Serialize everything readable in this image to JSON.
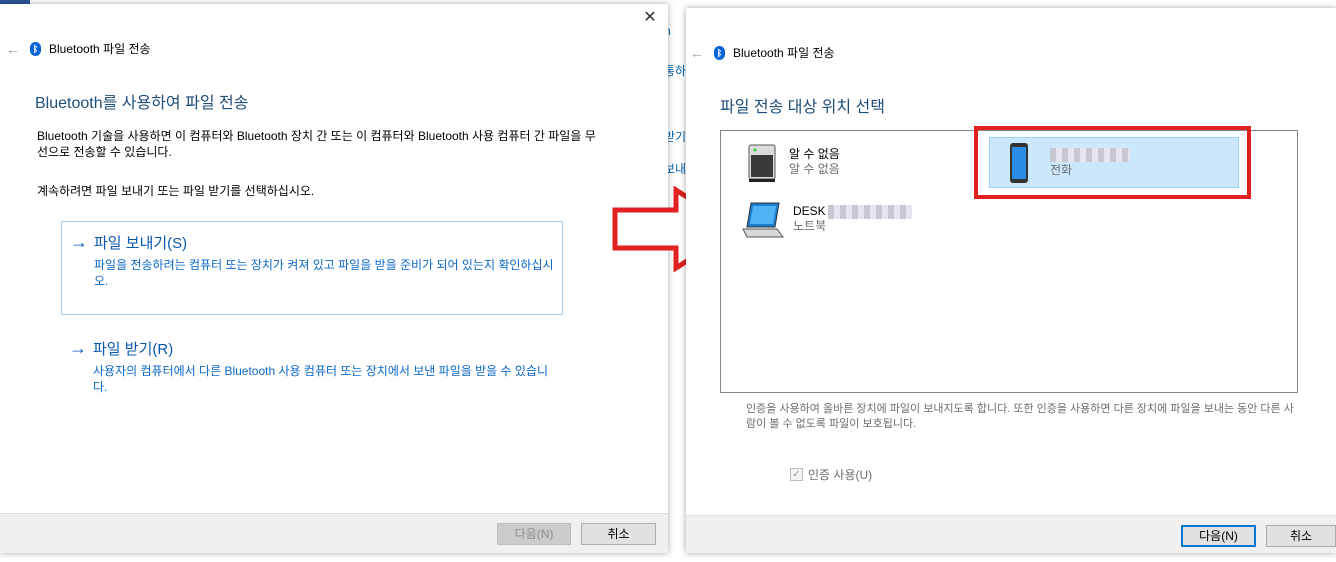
{
  "background": {
    "partial_texts": [
      "h",
      "통하",
      "받기",
      "보내"
    ]
  },
  "dialog1": {
    "title": "Bluetooth 파일 전송",
    "close_glyph": "✕",
    "heading": "Bluetooth를 사용하여 파일 전송",
    "description": "Bluetooth 기술을 사용하면 이 컴퓨터와 Bluetooth 장치 간 또는 이 컴퓨터와 Bluetooth 사용 컴퓨터 간 파일을 무선으로 전송할 수 있습니다.",
    "instruction": "계속하려면 파일 보내기 또는 파일 받기를 선택하십시오.",
    "send": {
      "title": "파일 보내기(S)",
      "description": "파일을 전송하려는 컴퓨터 또는 장치가 켜져 있고 파일을 받을 준비가 되어 있는지 확인하십시오."
    },
    "receive": {
      "title": "파일 받기(R)",
      "description": "사용자의 컴퓨터에서 다른 Bluetooth 사용 컴퓨터 또는 장치에서 보낸 파일을 받을 수 있습니다."
    },
    "next_label": "다음(N)",
    "cancel_label": "취소"
  },
  "dialog2": {
    "title": "Bluetooth 파일 전송",
    "heading": "파일 전송 대상 위치 선택",
    "devices": [
      {
        "name": "알 수 없음",
        "type": "알 수 없음",
        "icon": "server-icon"
      },
      {
        "name": "DESK",
        "type": "노트북",
        "icon": "laptop-icon"
      },
      {
        "name": "",
        "type": "전화",
        "icon": "phone-icon"
      }
    ],
    "info": "인증을 사용하여 올바른 장치에 파일이 보내지도록 합니다. 또한 인증을 사용하면 다른 장치에 파일을 보내는 동안 다른 사람이 볼 수 없도록 파일이 보호됩니다.",
    "auth_label": "인증 사용(U)",
    "auth_checked": true,
    "next_label": "다음(N)",
    "cancel_label": "취소"
  },
  "colors": {
    "heading": "#1e4e79",
    "link": "#0a57b0",
    "annotation_red": "#e12020",
    "selection": "#cce8ff"
  }
}
